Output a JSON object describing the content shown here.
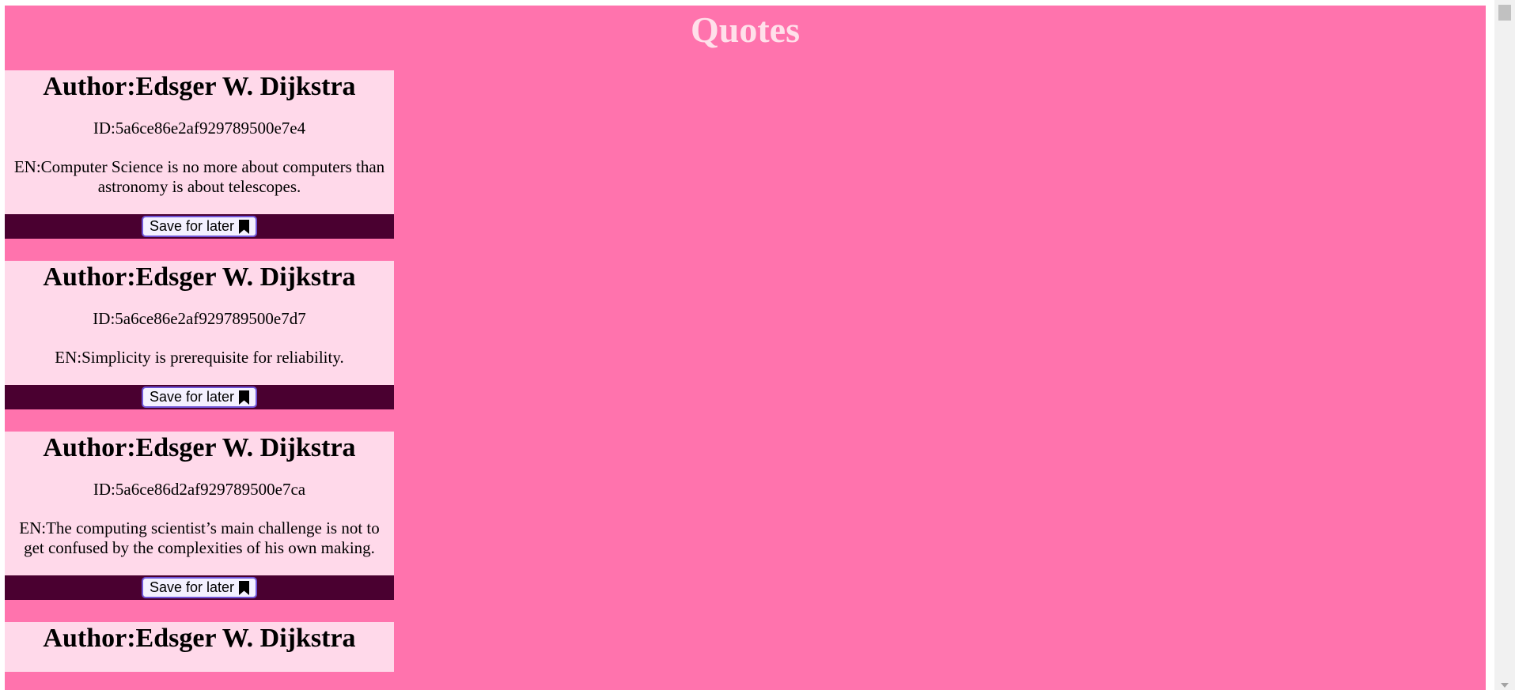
{
  "page": {
    "title": "Quotes"
  },
  "quotes": [
    {
      "author": "Author:Edsger W. Dijkstra",
      "id": "ID:5a6ce86e2af929789500e7e4",
      "text": "EN:Computer Science is no more about computers than astronomy is about telescopes.",
      "save_label": "Save for later"
    },
    {
      "author": "Author:Edsger W. Dijkstra",
      "id": "ID:5a6ce86e2af929789500e7d7",
      "text": "EN:Simplicity is prerequisite for reliability.",
      "save_label": "Save for later"
    },
    {
      "author": "Author:Edsger W. Dijkstra",
      "id": "ID:5a6ce86d2af929789500e7ca",
      "text": "EN:The computing scientist’s main challenge is not to get confused by the complexities of his own making.",
      "save_label": "Save for later"
    },
    {
      "author": "Author:Edsger W. Dijkstra"
    }
  ],
  "icons": {
    "save": "bookmark-icon"
  },
  "colors": {
    "page_background": "#ff73ad",
    "card_background": "#ffd9ea",
    "action_bar": "#4a0030",
    "title": "#ffe0ea",
    "button_border": "#6f55d8"
  }
}
